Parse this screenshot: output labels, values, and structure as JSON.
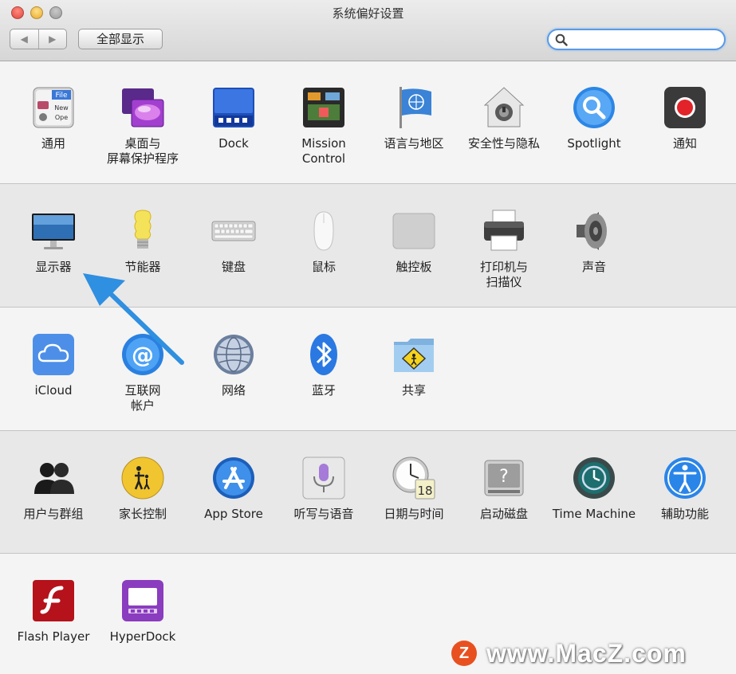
{
  "window": {
    "title": "系统偏好设置"
  },
  "toolbar": {
    "back": "◀",
    "forward": "▶",
    "show_all_label": "全部显示",
    "search_placeholder": ""
  },
  "colors": {
    "accent": "#2f8fe0",
    "search_border": "#5a9ae6"
  },
  "sections": [
    {
      "items": [
        {
          "label": "通用",
          "icon": "general-icon"
        },
        {
          "label": "桌面与\n屏幕保护程序",
          "icon": "desktop-screensaver-icon"
        },
        {
          "label": "Dock",
          "icon": "dock-icon"
        },
        {
          "label": "Mission\nControl",
          "icon": "mission-control-icon"
        },
        {
          "label": "语言与地区",
          "icon": "language-region-icon"
        },
        {
          "label": "安全性与隐私",
          "icon": "security-privacy-icon"
        },
        {
          "label": "Spotlight",
          "icon": "spotlight-icon"
        },
        {
          "label": "通知",
          "icon": "notifications-icon"
        }
      ]
    },
    {
      "items": [
        {
          "label": "显示器",
          "icon": "displays-icon"
        },
        {
          "label": "节能器",
          "icon": "energy-saver-icon"
        },
        {
          "label": "键盘",
          "icon": "keyboard-icon"
        },
        {
          "label": "鼠标",
          "icon": "mouse-icon"
        },
        {
          "label": "触控板",
          "icon": "trackpad-icon"
        },
        {
          "label": "打印机与\n扫描仪",
          "icon": "printer-scanner-icon"
        },
        {
          "label": "声音",
          "icon": "sound-icon"
        }
      ]
    },
    {
      "items": [
        {
          "label": "iCloud",
          "icon": "icloud-icon"
        },
        {
          "label": "互联网\n帐户",
          "icon": "internet-accounts-icon"
        },
        {
          "label": "网络",
          "icon": "network-icon"
        },
        {
          "label": "蓝牙",
          "icon": "bluetooth-icon"
        },
        {
          "label": "共享",
          "icon": "sharing-icon"
        }
      ]
    },
    {
      "items": [
        {
          "label": "用户与群组",
          "icon": "users-groups-icon"
        },
        {
          "label": "家长控制",
          "icon": "parental-controls-icon"
        },
        {
          "label": "App Store",
          "icon": "app-store-icon"
        },
        {
          "label": "听写与语音",
          "icon": "dictation-speech-icon"
        },
        {
          "label": "日期与时间",
          "icon": "date-time-icon",
          "badge": "18"
        },
        {
          "label": "启动磁盘",
          "icon": "startup-disk-icon"
        },
        {
          "label": "Time Machine",
          "icon": "time-machine-icon"
        },
        {
          "label": "辅助功能",
          "icon": "accessibility-icon"
        }
      ]
    },
    {
      "items": [
        {
          "label": "Flash Player",
          "icon": "flash-player-icon"
        },
        {
          "label": "HyperDock",
          "icon": "hyperdock-icon"
        }
      ]
    }
  ],
  "watermark": {
    "logo": "Z",
    "text": "www.MacZ.com"
  }
}
